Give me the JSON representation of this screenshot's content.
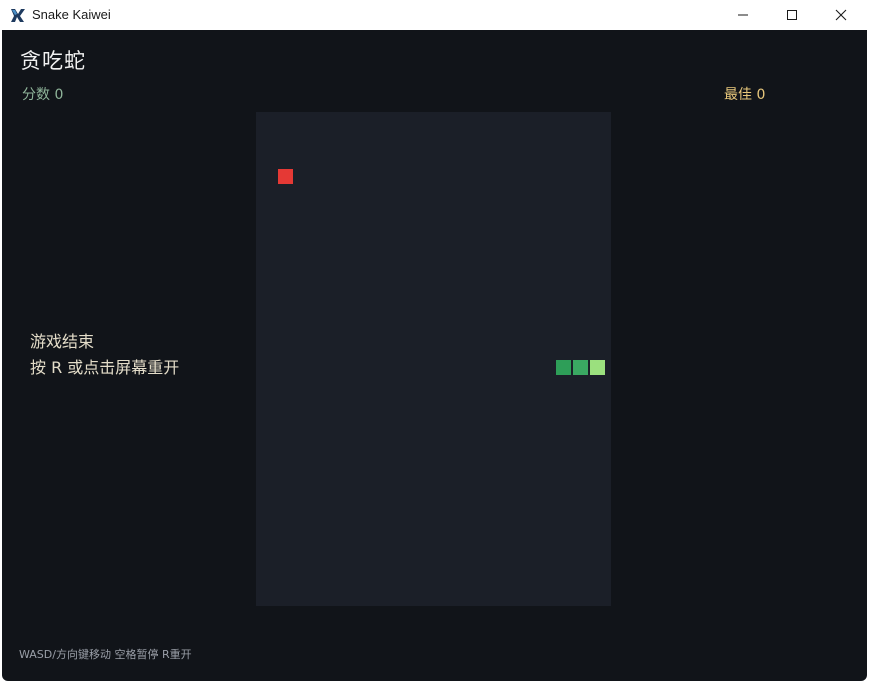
{
  "window": {
    "title": "Snake Kaiwei"
  },
  "game": {
    "title": "贪吃蛇",
    "score_text": "分数 0",
    "best_text": "最佳 0",
    "gameover_line1": "游戏结束",
    "gameover_line2": "按 R 或点击屏幕重开",
    "hint": "WASD/方向键移动  空格暂停  R重开"
  },
  "colors": {
    "food": "#e53935",
    "snake_body": "#2e9e58",
    "snake_head": "#9be07e",
    "board": "#1b1f28",
    "background": "#111419"
  }
}
